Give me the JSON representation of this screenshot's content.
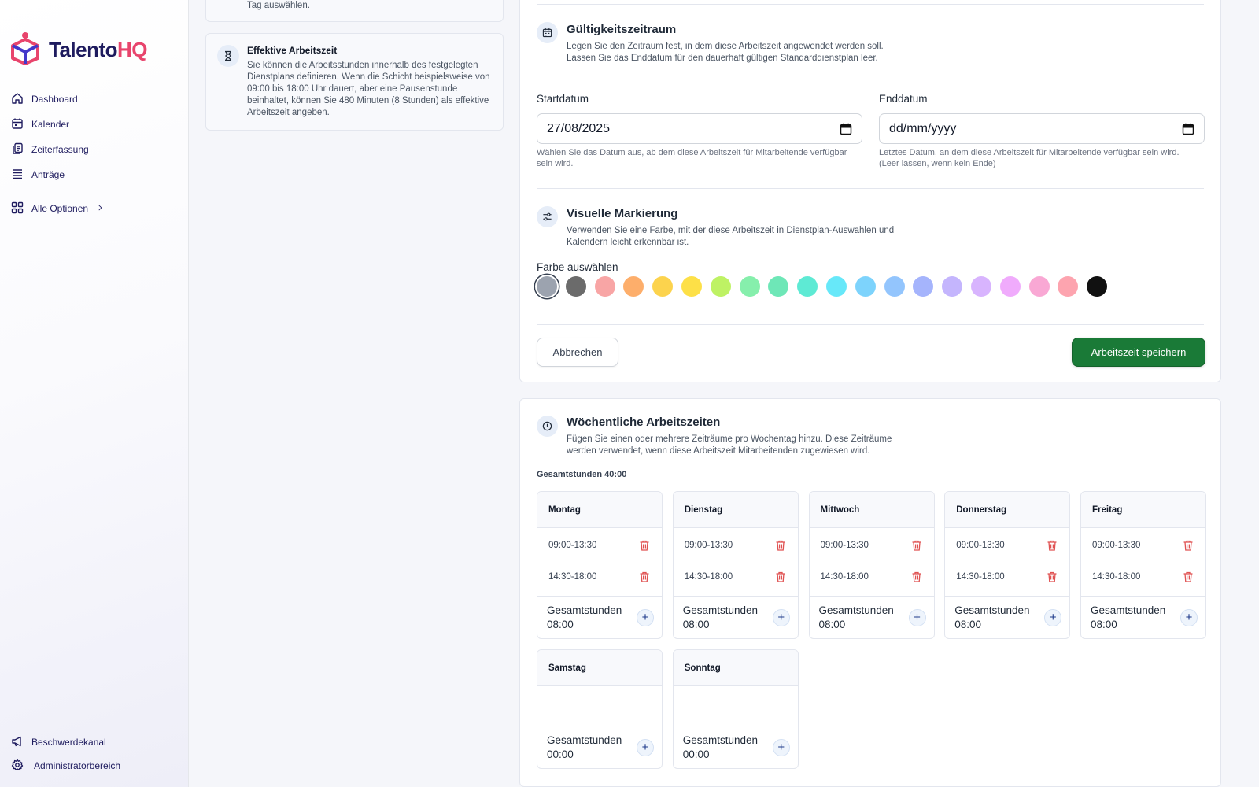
{
  "app": {
    "brand_main": "Talento",
    "brand_accent": "HQ",
    "brand_color": "#1e1b5e",
    "accent_color": "#e8446c"
  },
  "sidebar": {
    "items": [
      {
        "label": "Dashboard",
        "icon": "home-icon"
      },
      {
        "label": "Kalender",
        "icon": "calendar-icon"
      },
      {
        "label": "Zeiterfassung",
        "icon": "clipboard-icon"
      },
      {
        "label": "Anträge",
        "icon": "list-icon"
      }
    ],
    "all_options": "Alle Optionen",
    "bottom_items": [
      {
        "label": "Beschwerdekanal",
        "icon": "megaphone-icon"
      },
      {
        "label": "Administratorbereich",
        "icon": "gear-icon"
      }
    ]
  },
  "info": {
    "top_text": "Tag auswählen.",
    "title": "Effektive Arbeitszeit",
    "text": "Sie können die Arbeitsstunden innerhalb des festgelegten Dienstplans definieren. Wenn die Schicht beispielsweise von 09:00 bis 18:00 Uhr dauert, aber eine Pausenstunde beinhaltet, können Sie 480 Minuten (8 Stunden) als effektive Arbeitszeit angeben."
  },
  "validity": {
    "title": "Gültigkeitszeitraum",
    "desc": "Legen Sie den Zeitraum fest, in dem diese Arbeitszeit angewendet werden soll. Lassen Sie das Enddatum für den dauerhaft gültigen Standarddienstplan leer.",
    "start_label": "Startdatum",
    "start_value": "27/08/2025",
    "start_hint": "Wählen Sie das Datum aus, ab dem diese Arbeitszeit für Mitarbeitende verfügbar sein wird.",
    "end_label": "Enddatum",
    "end_placeholder": "dd/mm/yyyy",
    "end_hint": "Letztes Datum, an dem diese Arbeitszeit für Mitarbeitende verfügbar sein wird. (Leer lassen, wenn kein Ende)"
  },
  "marking": {
    "title": "Visuelle Markierung",
    "desc": "Verwenden Sie eine Farbe, mit der diese Arbeitszeit in Dienstplan-Auswahlen und Kalendern leicht erkennbar ist.",
    "color_label": "Farbe auswählen",
    "selected_index": 0,
    "colors": [
      "#9ca3af",
      "#6b6b6b",
      "#f8a5a5",
      "#fdae6b",
      "#fcd34d",
      "#fde047",
      "#bef264",
      "#86efac",
      "#6ee7b7",
      "#5eead4",
      "#67e8f9",
      "#7dd3fc",
      "#93c5fd",
      "#a5b4fc",
      "#c4b5fd",
      "#d8b4fe",
      "#f0abfc",
      "#f9a8d4",
      "#fda4af",
      "#111111"
    ]
  },
  "actions": {
    "cancel": "Abbrechen",
    "save": "Arbeitszeit speichern",
    "save_color": "#1a7a37"
  },
  "weekly": {
    "title": "Wöchentliche Arbeitszeiten",
    "desc": "Fügen Sie einen oder mehrere Zeiträume pro Wochentag hinzu. Diese Zeiträume werden verwendet, wenn diese Arbeitszeit Mitarbeitenden zugewiesen wird.",
    "total": "Gesamtstunden 40:00",
    "total_label": "Gesamtstunden",
    "days": [
      {
        "name": "Montag",
        "slots": [
          "09:00-13:30",
          "14:30-18:00"
        ],
        "total": "08:00"
      },
      {
        "name": "Dienstag",
        "slots": [
          "09:00-13:30",
          "14:30-18:00"
        ],
        "total": "08:00"
      },
      {
        "name": "Mittwoch",
        "slots": [
          "09:00-13:30",
          "14:30-18:00"
        ],
        "total": "08:00"
      },
      {
        "name": "Donnerstag",
        "slots": [
          "09:00-13:30",
          "14:30-18:00"
        ],
        "total": "08:00"
      },
      {
        "name": "Freitag",
        "slots": [
          "09:00-13:30",
          "14:30-18:00"
        ],
        "total": "08:00"
      },
      {
        "name": "Samstag",
        "slots": [],
        "total": "00:00"
      },
      {
        "name": "Sonntag",
        "slots": [],
        "total": "00:00"
      }
    ]
  }
}
